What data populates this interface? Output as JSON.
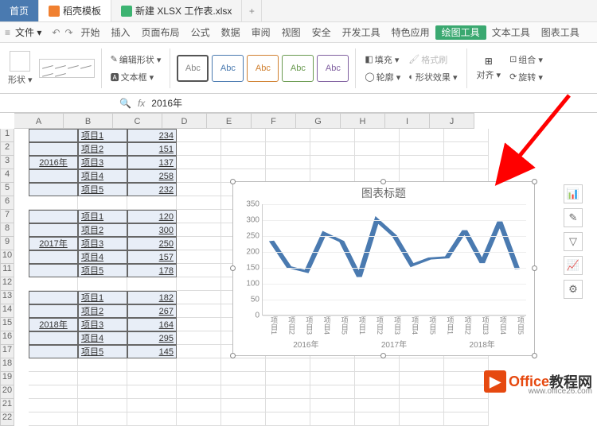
{
  "tabs": {
    "home": "首页",
    "dk": "稻壳模板",
    "file": "新建 XLSX 工作表.xlsx",
    "plus": "+"
  },
  "menu": {
    "file": "文件",
    "items": [
      "开始",
      "插入",
      "页面布局",
      "公式",
      "数据",
      "审阅",
      "视图",
      "安全",
      "开发工具",
      "特色应用",
      "绘图工具",
      "文本工具",
      "图表工具"
    ],
    "active": 10
  },
  "ribbon": {
    "shape": "形状",
    "editshape": "编辑形状 ▾",
    "textbox": "文本框 ▾",
    "abc": "Abc",
    "fill": "填充 ▾",
    "fmt": "格式刷",
    "outline": "轮廓 ▾",
    "effect": "形状效果 ▾",
    "align": "对齐 ▾",
    "group": "组合 ▾",
    "rotate": "旋转 ▾"
  },
  "fx": {
    "val": "2016年",
    "fx": "fx"
  },
  "cols": [
    "A",
    "B",
    "C",
    "D",
    "E",
    "F",
    "G",
    "H",
    "I",
    "J"
  ],
  "years": [
    "2016年",
    "2017年",
    "2018年"
  ],
  "items": [
    "项目1",
    "项目2",
    "项目3",
    "项目4",
    "项目5"
  ],
  "chart_data": {
    "type": "line",
    "title": "图表标题",
    "ylim": [
      0,
      350
    ],
    "yticks": [
      0,
      50,
      100,
      150,
      200,
      250,
      300,
      350
    ],
    "categories": [
      "项目1",
      "项目2",
      "项目3",
      "项目4",
      "项目5",
      "项目1",
      "项目2",
      "项目3",
      "项目4",
      "项目5",
      "项目1",
      "项目2",
      "项目3",
      "项目4",
      "项目5"
    ],
    "groups": [
      "2016年",
      "2017年",
      "2018年"
    ],
    "series": [
      {
        "name": "",
        "values": [
          234,
          151,
          137,
          258,
          232,
          120,
          300,
          250,
          157,
          178,
          182,
          267,
          164,
          295,
          145
        ]
      }
    ]
  },
  "watermark": {
    "brand": "Office",
    "suffix": "教程网",
    "url": "www.office26.com"
  }
}
